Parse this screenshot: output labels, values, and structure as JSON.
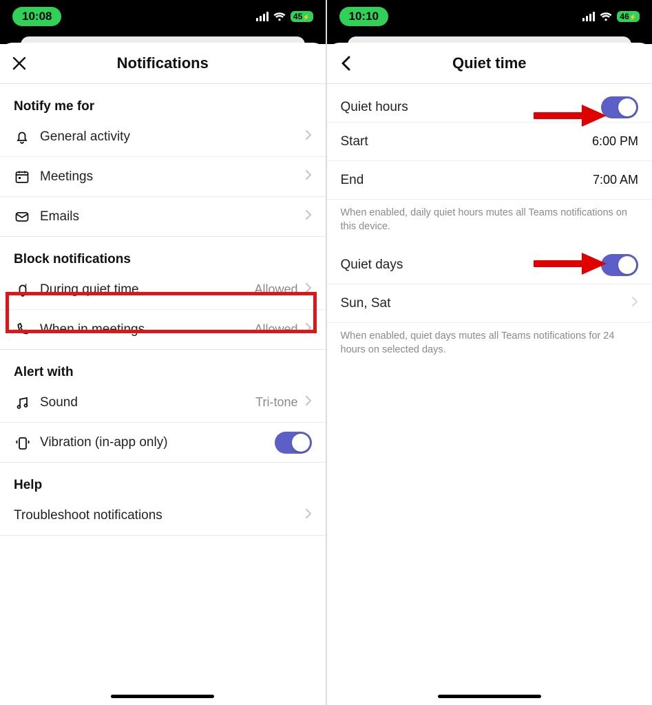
{
  "left": {
    "status": {
      "time": "10:08",
      "battery": "45"
    },
    "header": {
      "title": "Notifications"
    },
    "sections": {
      "notify_title": "Notify me for",
      "notify_items": [
        {
          "label": "General activity"
        },
        {
          "label": "Meetings"
        },
        {
          "label": "Emails"
        }
      ],
      "block_title": "Block notifications",
      "block_items": [
        {
          "label": "During quiet time",
          "value": "Allowed"
        },
        {
          "label": "When in meetings",
          "value": "Allowed"
        }
      ],
      "alert_title": "Alert with",
      "alert_sound": {
        "label": "Sound",
        "value": "Tri-tone"
      },
      "alert_vibration": {
        "label": "Vibration (in-app only)",
        "on": true
      },
      "help_title": "Help",
      "help_item": {
        "label": "Troubleshoot notifications"
      }
    }
  },
  "right": {
    "status": {
      "time": "10:10",
      "battery": "46"
    },
    "header": {
      "title": "Quiet time"
    },
    "quiet_hours": {
      "label": "Quiet hours",
      "on": true,
      "start_label": "Start",
      "start_value": "6:00 PM",
      "end_label": "End",
      "end_value": "7:00 AM",
      "hint": "When enabled, daily quiet hours mutes all Teams notifications on this device."
    },
    "quiet_days": {
      "label": "Quiet days",
      "on": true,
      "days_label": "Sun, Sat",
      "hint": "When enabled, quiet days mutes all Teams notifications for 24 hours on selected days."
    }
  }
}
